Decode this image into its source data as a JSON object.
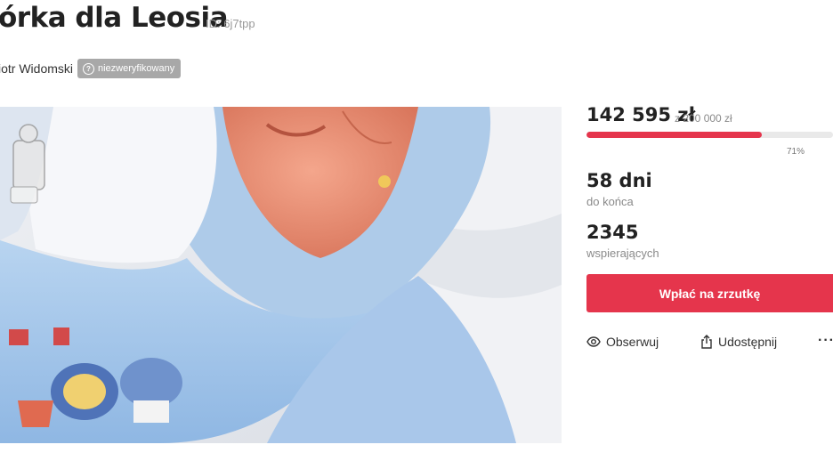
{
  "campaign": {
    "title": "órka dla Leosia",
    "id_label": "ID: 6j7tpp",
    "organizer": "iotr Widomski",
    "verification_badge": "niezweryfikowany"
  },
  "stats": {
    "raised": "142 595 zł",
    "goal": "z 200 000 zł",
    "progress_percent_label": "71%",
    "progress_fraction": 0.71,
    "days_value": "58 dni",
    "days_label": "do końca",
    "supporters_value": "2345",
    "supporters_label": "wspierających"
  },
  "actions": {
    "donate_label": "Wpłać na zrzutkę",
    "watch_label": "Obserwuj",
    "share_label": "Udostępnij",
    "more_label": "···"
  },
  "icons": {
    "badge": "question-circle-icon",
    "watch": "eye-icon",
    "share": "share-icon",
    "more": "more-dots-icon"
  },
  "colors": {
    "accent": "#e5354c",
    "badge_bg": "#a8a8a8",
    "muted_text": "#8a8a8a"
  }
}
